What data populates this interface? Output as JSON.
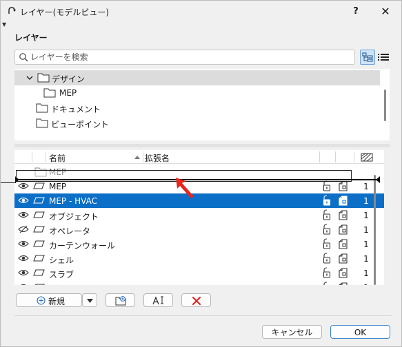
{
  "window": {
    "title": "レイヤー(モデルビュー)",
    "help_label": "?",
    "close_label": "✕"
  },
  "section": {
    "title": "レイヤー"
  },
  "search": {
    "placeholder": "レイヤーを検索",
    "value": ""
  },
  "tree": {
    "items": [
      {
        "label": "デザイン",
        "expanded": true,
        "selected": true
      },
      {
        "label": "MEP"
      },
      {
        "label": "ドキュメント"
      },
      {
        "label": "ビューポイント"
      }
    ]
  },
  "table": {
    "columns": {
      "name": "名前",
      "extension": "拡張名"
    },
    "drag_label": "MEP",
    "rows": [
      {
        "name": "MEP",
        "visible": true,
        "number": "1"
      },
      {
        "name": "MEP - HVAC",
        "visible": true,
        "number": "1",
        "selected": true
      },
      {
        "name": "オブジェクト",
        "visible": true,
        "number": "1"
      },
      {
        "name": "オペレータ",
        "visible": false,
        "number": "1"
      },
      {
        "name": "カーテンウォール",
        "visible": true,
        "number": "1"
      },
      {
        "name": "シェル",
        "visible": true,
        "number": "1"
      },
      {
        "name": "スラブ",
        "visible": true,
        "number": "1"
      },
      {
        "name": "ゾーン",
        "visible": true,
        "number": "1"
      }
    ]
  },
  "buttons": {
    "new_label": "新規",
    "cancel_label": "キャンセル",
    "ok_label": "OK"
  },
  "colors": {
    "selection": "#0c6fc7",
    "accent_red": "#e8261d",
    "tree_selected": "#dcdcdc"
  }
}
